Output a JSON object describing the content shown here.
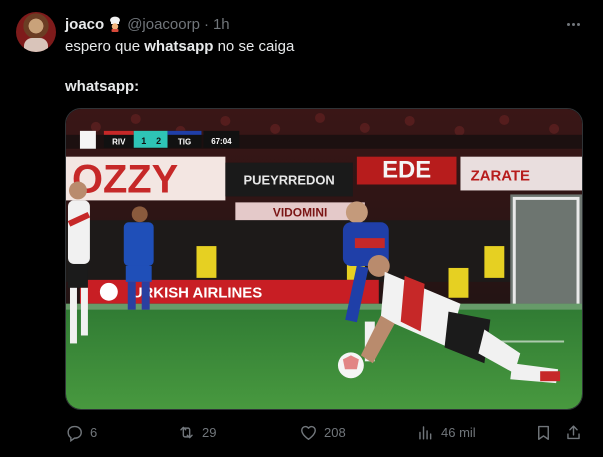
{
  "tweet": {
    "author_name": "joaco",
    "handle": "@joacoorp",
    "separator": "·",
    "time": "1h",
    "line1_prefix": "espero que ",
    "line1_bold": "whatsapp",
    "line1_suffix": " no se caiga",
    "line2_bold": "whatsapp:"
  },
  "media": {
    "scoreboard": {
      "home": "RIV",
      "home_score": "1",
      "away_score": "2",
      "away": "TIG",
      "clock": "67:04"
    },
    "banners": [
      "OZZY",
      "PUEYRREDON",
      "EDE",
      "ZARATE",
      "VIDOMINI"
    ],
    "ad_board": "URKISH AIRLINES"
  },
  "actions": {
    "replies": "6",
    "reposts": "29",
    "likes": "208",
    "views": "46 mil"
  },
  "colors": {
    "background": "#000000",
    "text": "#e7e9ea",
    "muted": "#71767b",
    "pitch": "#3d8a3a"
  }
}
